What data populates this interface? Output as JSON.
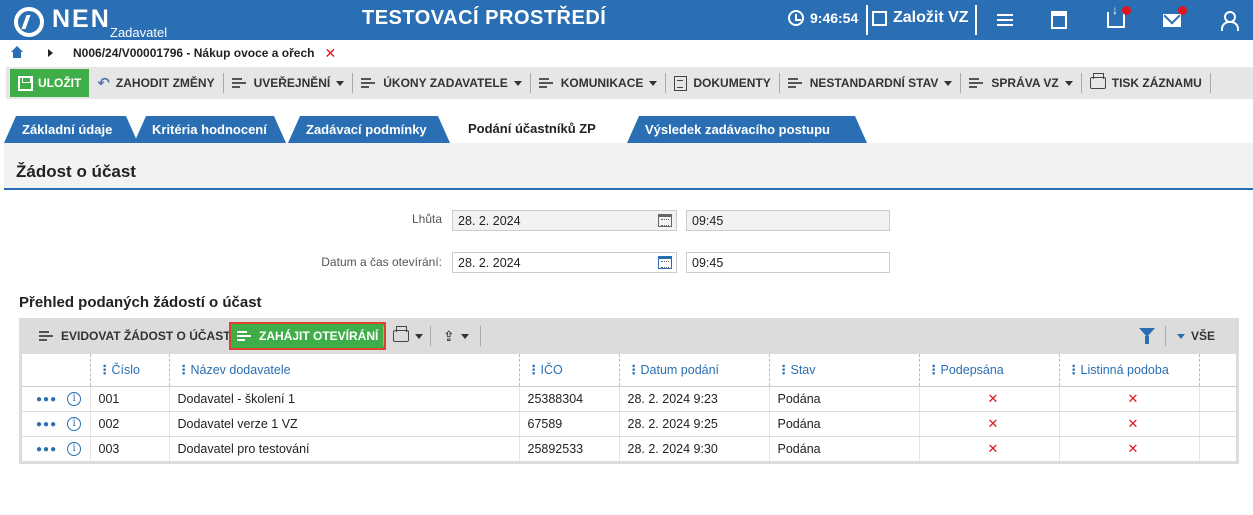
{
  "header": {
    "logo_text": "NEN",
    "logo_sub": "Zadavatel",
    "environment": "TESTOVACÍ PROSTŘEDÍ",
    "time": "9:46:54",
    "create_vz": "Založit VZ",
    "accent_color": "#2a6fb3"
  },
  "breadcrumb": {
    "text": "N006/24/V00001796 - Nákup ovoce a ořech"
  },
  "toolbar": {
    "save": "ULOŽIT",
    "discard": "ZAHODIT ZMĚNY",
    "publish": "UVEŘEJNĚNÍ",
    "actions": "ÚKONY ZADAVATELE",
    "communication": "KOMUNIKACE",
    "documents": "DOKUMENTY",
    "nonstandard": "NESTANDARDNÍ STAV",
    "manage": "SPRÁVA VZ",
    "print": "TISK ZÁZNAMU"
  },
  "tabs": [
    {
      "label": "Základní údaje"
    },
    {
      "label": "Kritéria hodnocení"
    },
    {
      "label": "Zadávací podmínky"
    },
    {
      "label": "Podání účastníků ZP",
      "active": true
    },
    {
      "label": "Výsledek zadávacího postupu"
    }
  ],
  "section": {
    "title": "Žádost o účast"
  },
  "form": {
    "deadline_label": "Lhůta",
    "deadline_date": "28. 2. 2024",
    "deadline_time": "09:45",
    "opening_label": "Datum a čas otevírání:",
    "opening_date": "28. 2. 2024",
    "opening_time": "09:45"
  },
  "overview": {
    "title": "Přehled podaných žádostí o účast",
    "btn_register": "EVIDOVAT ŽÁDOST O ÚČAST",
    "btn_start": "ZAHÁJIT OTEVÍRÁNÍ",
    "all_label": "VŠE",
    "columns": [
      "Číslo",
      "Název dodavatele",
      "IČO",
      "Datum podání",
      "Stav",
      "Podepsána",
      "Listinná podoba"
    ],
    "rows": [
      {
        "number": "001",
        "supplier": "Dodavatel - školení 1",
        "ico": "25388304",
        "date": "28. 2. 2024 9:23",
        "status": "Podána",
        "signed": "✕",
        "paper": "✕"
      },
      {
        "number": "002",
        "supplier": "Dodavatel verze 1 VZ",
        "ico": "67589",
        "date": "28. 2. 2024 9:25",
        "status": "Podána",
        "signed": "✕",
        "paper": "✕"
      },
      {
        "number": "003",
        "supplier": "Dodavatel pro testování",
        "ico": "25892533",
        "date": "28. 2. 2024 9:30",
        "status": "Podána",
        "signed": "✕",
        "paper": "✕"
      }
    ]
  }
}
